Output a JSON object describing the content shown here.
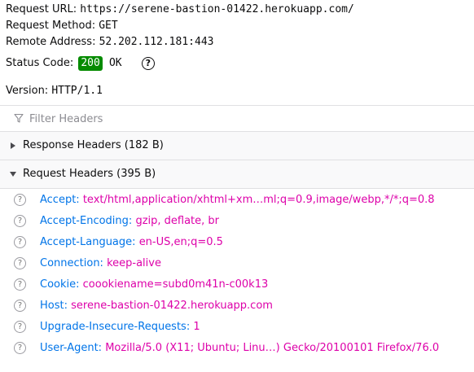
{
  "summary": {
    "request_url_label": "Request URL:",
    "request_url": "https://serene-bastion-01422.herokuapp.com/",
    "request_method_label": "Request Method:",
    "request_method": "GET",
    "remote_address_label": "Remote Address:",
    "remote_address": "52.202.112.181:443",
    "status_code_label": "Status Code:",
    "status_code": "200",
    "status_text": "OK",
    "version_label": "Version:",
    "version": "HTTP/1.1"
  },
  "filter": {
    "placeholder": "Filter Headers"
  },
  "response_headers": {
    "title": "Response Headers (182 B)",
    "expanded": false
  },
  "request_headers": {
    "title": "Request Headers (395 B)",
    "expanded": true,
    "items": [
      {
        "name": "Accept:",
        "value": "text/html,application/xhtml+xm…ml;q=0.9,image/webp,*/*;q=0.8"
      },
      {
        "name": "Accept-Encoding:",
        "value": "gzip, deflate, br"
      },
      {
        "name": "Accept-Language:",
        "value": "en-US,en;q=0.5"
      },
      {
        "name": "Connection:",
        "value": "keep-alive"
      },
      {
        "name": "Cookie:",
        "value": "coookiename=subd0m41n-c00k13"
      },
      {
        "name": "Host:",
        "value": "serene-bastion-01422.herokuapp.com"
      },
      {
        "name": "Upgrade-Insecure-Requests:",
        "value": "1"
      },
      {
        "name": "User-Agent:",
        "value": "Mozilla/5.0 (X11; Ubuntu; Linu…) Gecko/20100101 Firefox/76.0"
      }
    ]
  },
  "colors": {
    "header_name": "#0074e8",
    "header_value": "#dd00a9",
    "status_ok": "#058b00"
  },
  "icons": {
    "filter": "filter-funnel-icon",
    "help": "question-circle-icon",
    "collapsed": "triangle-right-icon",
    "expanded": "triangle-down-icon"
  }
}
